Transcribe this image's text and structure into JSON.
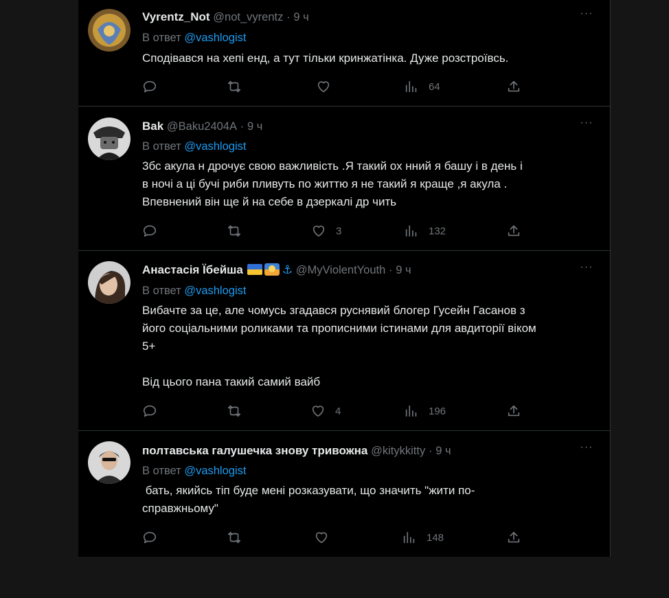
{
  "tweets": [
    {
      "name": "Vyrentz_Not",
      "handle": "@not_vyrentz",
      "sep": "·",
      "time": "9 ч",
      "reply_prefix": "В ответ",
      "reply_to": "@vashlogist",
      "text": "Сподівався на хепі енд, а тут тільки кринжатінка. Дуже розстроївсь.",
      "likes": "",
      "retweets": "",
      "views": "64"
    },
    {
      "name": "Bak",
      "handle": "@Baku2404A",
      "sep": "·",
      "time": "9 ч",
      "reply_prefix": "В ответ",
      "reply_to": "@vashlogist",
      "text": "3бс акула н дрочує свою важливість .Я такий ох нний я башу і в день і\nв ночі а ці бучі риби пливуть по життю я не такий я краще ,я акула .\nВпевнений він ще й на себе в дзеркалі др чить",
      "likes": "3",
      "retweets": "",
      "views": "132"
    },
    {
      "name": "Анастасія Їбейша",
      "handle": "@MyViolentYouth",
      "sep": "·",
      "time": "9 ч",
      "reply_prefix": "В ответ",
      "reply_to": "@vashlogist",
      "text": "Вибачте за це, але чомусь згадався руснявий блогер Гусейн Гасанов з\nйого соціальними роликами та прописними істинами для авдиторії віком\n5+\n\nВід цього пана такий самий вайб",
      "likes": "4",
      "retweets": "",
      "views": "196"
    },
    {
      "name": "полтавська галушечка знову тривожна",
      "handle": "@kitykkitty",
      "sep": "·",
      "time": "9 ч",
      "reply_prefix": "В ответ",
      "reply_to": "@vashlogist",
      "text": " бать, якийсь тіп буде мені розказувати, що значить \"жити по-\nсправжньому\"",
      "likes": "",
      "retweets": "",
      "views": "148"
    }
  ],
  "more_icon": "···",
  "icons": {
    "reply": "reply-icon",
    "retweet": "retweet-icon",
    "like": "heart-icon",
    "views": "views-icon",
    "share": "share-icon"
  },
  "colors": {
    "background": "#000000",
    "page": "#151515",
    "text": "#e7e9ea",
    "muted": "#71767b",
    "accent": "#1d9bf0",
    "border": "#2f3336"
  }
}
